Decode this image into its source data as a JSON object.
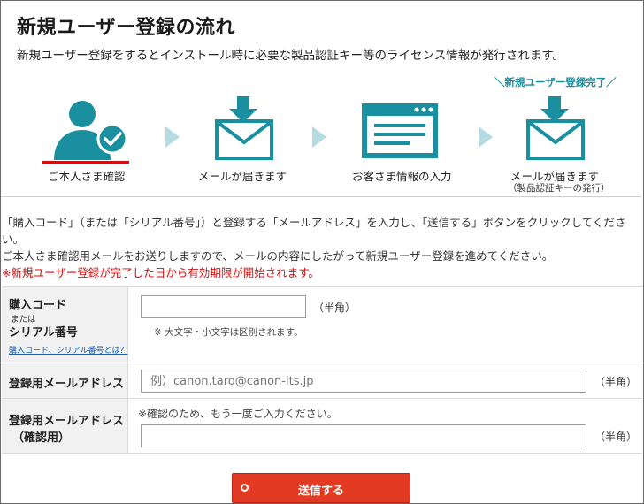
{
  "flow": {
    "title": "新規ユーザー登録の流れ",
    "description": "新規ユーザー登録をするとインストール時に必要な製品認証キー等のライセンス情報が発行されます。",
    "complete_label": "＼新規ユーザー登録完了／",
    "steps": [
      {
        "label": "ご本人さま確認",
        "icon": "user-check-icon"
      },
      {
        "label": "メールが届きます",
        "icon": "mail-arrow-icon"
      },
      {
        "label": "お客さま情報の入力",
        "icon": "browser-form-icon"
      },
      {
        "label": "メールが届きます",
        "sublabel": "（製品認証キーの発行）",
        "icon": "mail-arrow-icon"
      }
    ],
    "accent_color": "#1a8fa0",
    "arrow_color": "#b5dbe2"
  },
  "notes": {
    "line1": "「購入コード」（または「シリアル番号」）と登録する「メールアドレス」を入力し、「送信する」ボタンをクリックしてください。",
    "line2": "ご本人さま確認用メールをお送りしますので、メールの内容にしたがって新規ユーザー登録を進めてください。",
    "line3": "※新規ユーザー登録が完了した日から有効期限が開始されます。"
  },
  "form": {
    "purchase": {
      "label_main": "購入コード",
      "label_or": "または",
      "label_serial": "シリアル番号",
      "help_link": "購入コード、シリアル番号とは？",
      "value": "",
      "unit": "（半角）",
      "hint": "※  大文字・小文字は区別されます。"
    },
    "email": {
      "label": "登録用メールアドレス",
      "placeholder": "例）canon.taro@canon-its.jp",
      "value": "",
      "unit": "（半角）"
    },
    "email_confirm": {
      "label_line1": "登録用メールアドレス",
      "label_line2": "（確認用）",
      "note": "※確認のため、もう一度ご入力ください。",
      "value": "",
      "unit": "（半角）"
    }
  },
  "submit": {
    "label": "送信する",
    "color": "#e33b23"
  }
}
